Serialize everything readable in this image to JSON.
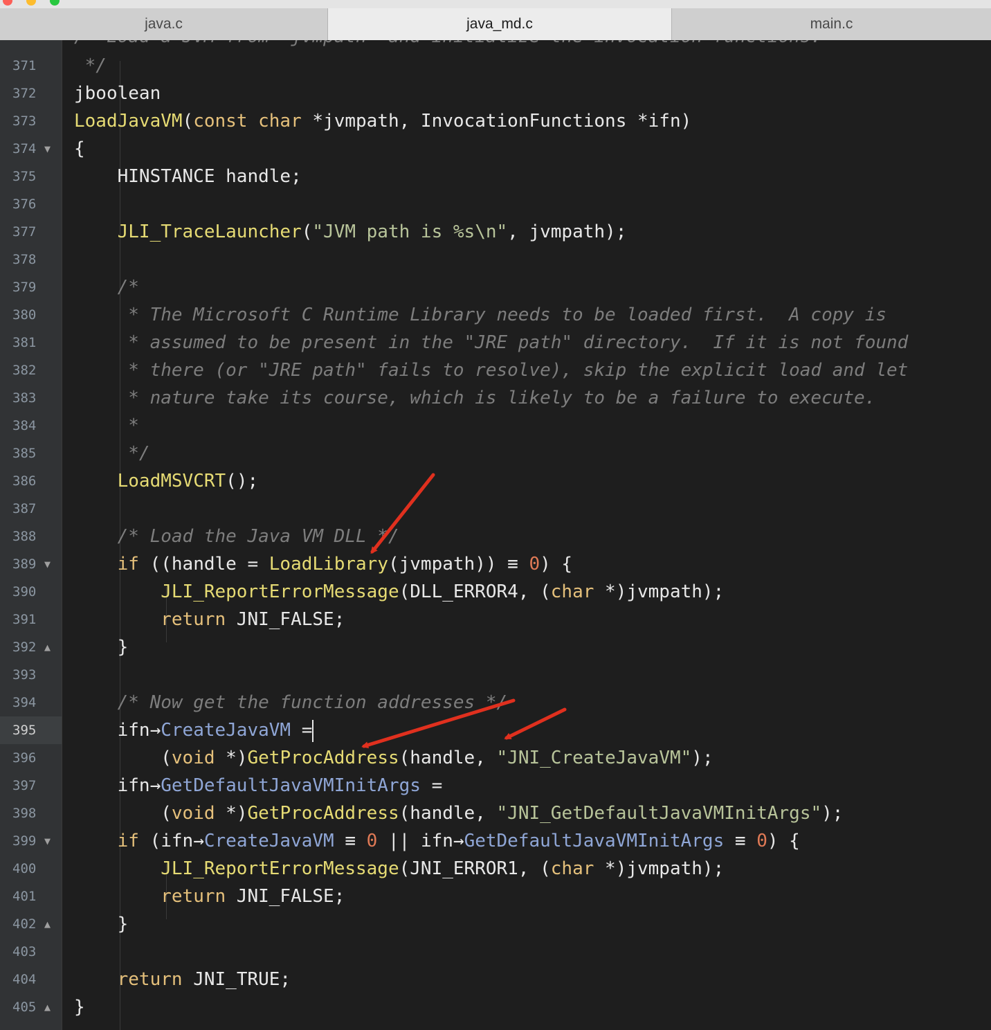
{
  "tabs": [
    {
      "label": "java.c",
      "active": false
    },
    {
      "label": "java_md.c",
      "active": true
    },
    {
      "label": "main.c",
      "active": false
    }
  ],
  "editor": {
    "first_line_partial": "/* Load a JVM from \"jvmpath\" and initialize the invocation functions.",
    "current_line": "395",
    "lines": [
      {
        "n": "371",
        "fold": ""
      },
      {
        "n": "372",
        "fold": ""
      },
      {
        "n": "373",
        "fold": ""
      },
      {
        "n": "374",
        "fold": "▼"
      },
      {
        "n": "375",
        "fold": ""
      },
      {
        "n": "376",
        "fold": ""
      },
      {
        "n": "377",
        "fold": ""
      },
      {
        "n": "378",
        "fold": ""
      },
      {
        "n": "379",
        "fold": ""
      },
      {
        "n": "380",
        "fold": ""
      },
      {
        "n": "381",
        "fold": ""
      },
      {
        "n": "382",
        "fold": ""
      },
      {
        "n": "383",
        "fold": ""
      },
      {
        "n": "384",
        "fold": ""
      },
      {
        "n": "385",
        "fold": ""
      },
      {
        "n": "386",
        "fold": ""
      },
      {
        "n": "387",
        "fold": ""
      },
      {
        "n": "388",
        "fold": ""
      },
      {
        "n": "389",
        "fold": "▼"
      },
      {
        "n": "390",
        "fold": ""
      },
      {
        "n": "391",
        "fold": ""
      },
      {
        "n": "392",
        "fold": "▲"
      },
      {
        "n": "393",
        "fold": ""
      },
      {
        "n": "394",
        "fold": ""
      },
      {
        "n": "395",
        "fold": ""
      },
      {
        "n": "396",
        "fold": ""
      },
      {
        "n": "397",
        "fold": ""
      },
      {
        "n": "398",
        "fold": ""
      },
      {
        "n": "399",
        "fold": "▼"
      },
      {
        "n": "400",
        "fold": ""
      },
      {
        "n": "401",
        "fold": ""
      },
      {
        "n": "402",
        "fold": "▲"
      },
      {
        "n": "403",
        "fold": ""
      },
      {
        "n": "404",
        "fold": ""
      },
      {
        "n": "405",
        "fold": "▲"
      }
    ],
    "code": [
      [
        [
          "cm",
          " */"
        ]
      ],
      [
        [
          "",
          "jboolean"
        ]
      ],
      [
        [
          "fn",
          "LoadJavaVM"
        ],
        [
          "",
          "("
        ],
        [
          "k",
          "const char"
        ],
        [
          "",
          " *jvmpath, InvocationFunctions *ifn)"
        ]
      ],
      [
        [
          "",
          "{"
        ]
      ],
      [
        [
          "",
          "    HINSTANCE handle;"
        ]
      ],
      [],
      [
        [
          "",
          "    "
        ],
        [
          "fn",
          "JLI_TraceLauncher"
        ],
        [
          "",
          "("
        ],
        [
          "st",
          "\"JVM path is %s\\n\""
        ],
        [
          "",
          ", jvmpath);"
        ]
      ],
      [],
      [
        [
          "cm",
          "    /*"
        ]
      ],
      [
        [
          "cm",
          "     * The Microsoft C Runtime Library needs to be loaded first.  A copy is"
        ]
      ],
      [
        [
          "cm",
          "     * assumed to be present in the \"JRE path\" directory.  If it is not found"
        ]
      ],
      [
        [
          "cm",
          "     * there (or \"JRE path\" fails to resolve), skip the explicit load and let"
        ]
      ],
      [
        [
          "cm",
          "     * nature take its course, which is likely to be a failure to execute."
        ]
      ],
      [
        [
          "cm",
          "     *"
        ]
      ],
      [
        [
          "cm",
          "     */"
        ]
      ],
      [
        [
          "",
          "    "
        ],
        [
          "fn",
          "LoadMSVCRT"
        ],
        [
          "",
          "();"
        ]
      ],
      [],
      [
        [
          "cm",
          "    /* Load the Java VM DLL */"
        ]
      ],
      [
        [
          "",
          "    "
        ],
        [
          "kw",
          "if"
        ],
        [
          "",
          " ((handle = "
        ],
        [
          "fn",
          "LoadLibrary"
        ],
        [
          "",
          "(jvmpath)) ≡ "
        ],
        [
          "nm",
          "0"
        ],
        [
          "",
          ") {"
        ]
      ],
      [
        [
          "",
          "        "
        ],
        [
          "fn",
          "JLI_ReportErrorMessage"
        ],
        [
          "",
          "(DLL_ERROR4, ("
        ],
        [
          "k",
          "char"
        ],
        [
          "",
          " *)jvmpath);"
        ]
      ],
      [
        [
          "",
          "        "
        ],
        [
          "kw",
          "return"
        ],
        [
          "",
          " JNI_FALSE;"
        ]
      ],
      [
        [
          "",
          "    }"
        ]
      ],
      [],
      [
        [
          "cm",
          "    /* Now get the function addresses */"
        ]
      ],
      [
        [
          "",
          "    ifn→"
        ],
        [
          "fp",
          "CreateJavaVM"
        ],
        [
          "",
          " ="
        ],
        [
          "caret",
          ""
        ]
      ],
      [
        [
          "",
          "        ("
        ],
        [
          "k",
          "void"
        ],
        [
          "",
          " *)"
        ],
        [
          "fn",
          "GetProcAddress"
        ],
        [
          "",
          "(handle, "
        ],
        [
          "st",
          "\"JNI_CreateJavaVM\""
        ],
        [
          "",
          ");"
        ]
      ],
      [
        [
          "",
          "    ifn→"
        ],
        [
          "fp",
          "GetDefaultJavaVMInitArgs"
        ],
        [
          "",
          " ="
        ]
      ],
      [
        [
          "",
          "        ("
        ],
        [
          "k",
          "void"
        ],
        [
          "",
          " *)"
        ],
        [
          "fn",
          "GetProcAddress"
        ],
        [
          "",
          "(handle, "
        ],
        [
          "st",
          "\"JNI_GetDefaultJavaVMInitArgs\""
        ],
        [
          "",
          ");"
        ]
      ],
      [
        [
          "",
          "    "
        ],
        [
          "kw",
          "if"
        ],
        [
          "",
          " (ifn→"
        ],
        [
          "fp",
          "CreateJavaVM"
        ],
        [
          "",
          " ≡ "
        ],
        [
          "nm",
          "0"
        ],
        [
          "",
          " || ifn→"
        ],
        [
          "fp",
          "GetDefaultJavaVMInitArgs"
        ],
        [
          "",
          " ≡ "
        ],
        [
          "nm",
          "0"
        ],
        [
          "",
          ") {"
        ]
      ],
      [
        [
          "",
          "        "
        ],
        [
          "fn",
          "JLI_ReportErrorMessage"
        ],
        [
          "",
          "(JNI_ERROR1, ("
        ],
        [
          "k",
          "char"
        ],
        [
          "",
          " *)jvmpath);"
        ]
      ],
      [
        [
          "",
          "        "
        ],
        [
          "kw",
          "return"
        ],
        [
          "",
          " JNI_FALSE;"
        ]
      ],
      [
        [
          "",
          "    }"
        ]
      ],
      [],
      [
        [
          "",
          "    "
        ],
        [
          "kw",
          "return"
        ],
        [
          "",
          " JNI_TRUE;"
        ]
      ],
      [
        [
          "",
          "}"
        ]
      ]
    ]
  },
  "annotation_color": "#e0301e"
}
